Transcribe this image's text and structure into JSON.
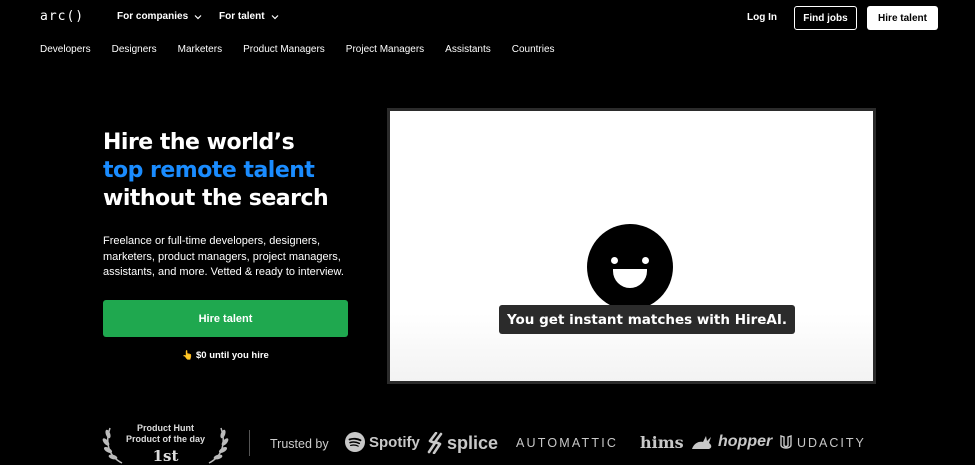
{
  "header": {
    "logo": "arc()",
    "nav": [
      {
        "label": "For companies"
      },
      {
        "label": "For talent"
      }
    ],
    "login": "Log In",
    "find_jobs": "Find jobs",
    "hire_talent": "Hire talent"
  },
  "subnav": [
    "Developers",
    "Designers",
    "Marketers",
    "Product Managers",
    "Project Managers",
    "Assistants",
    "Countries"
  ],
  "hero": {
    "title_line1": "Hire the world’s",
    "title_line2": "top remote talent",
    "title_line3": "without the search",
    "description": "Freelance or full-time developers, designers, marketers, product managers, project managers, assistants, and more. Vetted & ready to interview.",
    "cta": "Hire talent",
    "note_icon": "👆",
    "note": "$0 until you hire",
    "accent_color": "#1a8cff",
    "cta_color": "#1fa84f"
  },
  "video": {
    "icon": "smiley-face-icon",
    "caption": "You get instant matches with HireAI."
  },
  "trust": {
    "badge_line1": "Product Hunt",
    "badge_line2": "Product of the day",
    "badge_rank": "1st",
    "label": "Trusted by",
    "logos": [
      "Spotify",
      "splice",
      "AUTOMATTIC",
      "hims",
      "hopper",
      "UDACITY"
    ]
  }
}
